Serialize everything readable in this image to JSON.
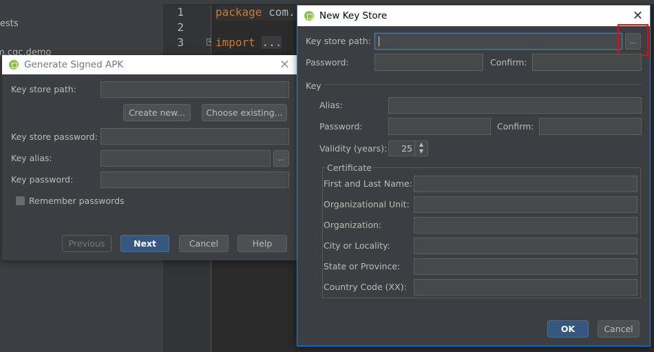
{
  "project_tree": {
    "items": [
      "ests",
      "m.cgc.demo"
    ]
  },
  "editor": {
    "line_numbers": [
      "1",
      "2",
      "3"
    ],
    "lines": [
      {
        "keyword": "package",
        "rest": " com."
      },
      {
        "keyword": "",
        "rest": ""
      },
      {
        "keyword": "import",
        "rest": "..."
      }
    ]
  },
  "generate_dialog": {
    "title": "Generate Signed APK",
    "key_store_path_label": "Key store path:",
    "create_new": "Create new...",
    "choose_existing": "Choose existing...",
    "key_store_password_label": "Key store password:",
    "key_alias_label": "Key alias:",
    "browse": "...",
    "key_password_label": "Key password:",
    "remember_passwords": "Remember passwords",
    "remember_checked": false,
    "previous": "Previous",
    "next": "Next",
    "cancel": "Cancel",
    "help": "Help"
  },
  "new_key_store": {
    "title": "New Key Store",
    "key_store_path_label": "Key store path:",
    "key_store_path_value": "",
    "browse": "...",
    "password_label": "Password:",
    "confirm_label": "Confirm:",
    "key_section": "Key",
    "alias_label": "Alias:",
    "key_password_label": "Password:",
    "key_confirm_label": "Confirm:",
    "validity_label": "Validity (years):",
    "validity_value": "25",
    "certificate_section": "Certificate",
    "cert_fields": [
      "First and Last Name:",
      "Organizational Unit:",
      "Organization:",
      "City or Locality:",
      "State or Province:",
      "Country Code (XX):"
    ],
    "ok": "OK",
    "cancel": "Cancel",
    "highlight_color": "#ff0000"
  }
}
